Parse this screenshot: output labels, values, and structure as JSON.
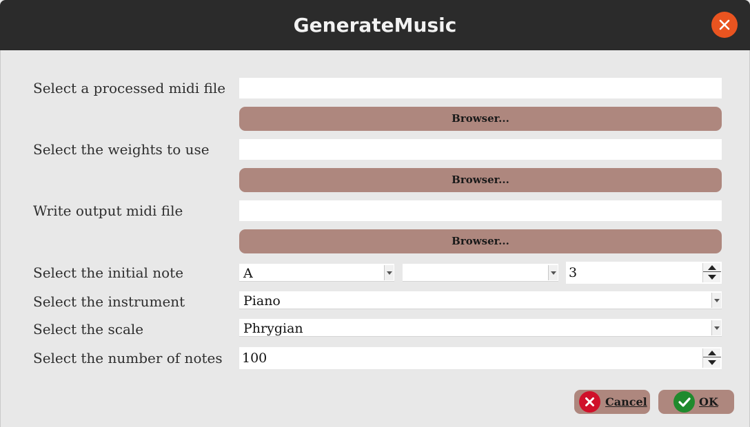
{
  "window": {
    "title": "GenerateMusic"
  },
  "form": {
    "processed_midi_label": "Select a processed midi file",
    "processed_midi_value": "",
    "weights_label": "Select the weights to use",
    "weights_value": "",
    "output_midi_label": "Write output midi file",
    "output_midi_value": "",
    "browse_label": "Browser...",
    "initial_note_label": "Select the initial note",
    "initial_note": {
      "note": "A",
      "accidental": "",
      "octave": "3"
    },
    "instrument_label": "Select the instrument",
    "instrument_value": "Piano",
    "scale_label": "Select the scale",
    "scale_value": "Phrygian",
    "num_notes_label": "Select the number of notes",
    "num_notes_value": "100"
  },
  "buttons": {
    "cancel": "Cancel",
    "ok": "OK"
  },
  "colors": {
    "titlebar": "#2b2b2b",
    "close": "#e95420",
    "button": "#ae877e",
    "cancel_icon": "#d0102a",
    "ok_icon": "#1f8a2d"
  },
  "icons": {
    "close": "close-icon",
    "cancel": "cancel-icon",
    "ok": "check-icon"
  }
}
